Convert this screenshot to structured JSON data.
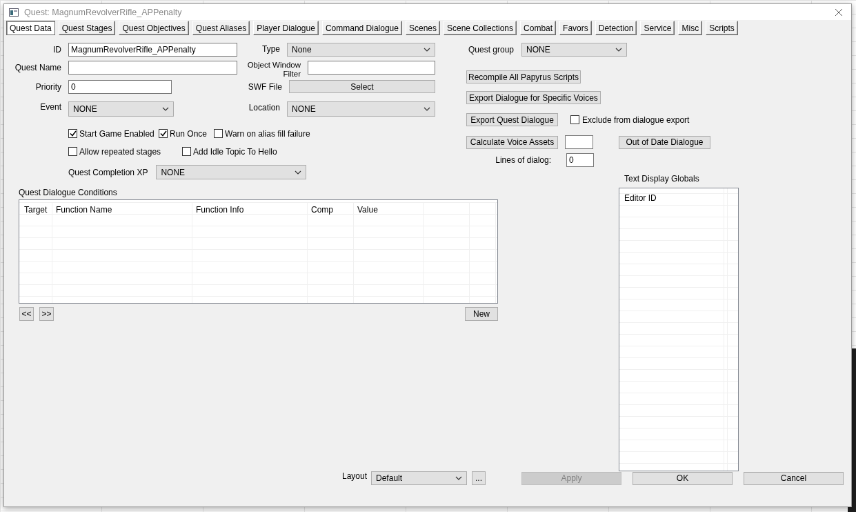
{
  "window": {
    "title": "Quest: MagnumRevolverRifle_APPenalty"
  },
  "tabs": [
    {
      "label": "Quest Data",
      "selected": true
    },
    {
      "label": "Quest Stages",
      "selected": false
    },
    {
      "label": "Quest Objectives",
      "selected": false
    },
    {
      "label": "Quest Aliases",
      "selected": false
    },
    {
      "label": "Player Dialogue",
      "selected": false
    },
    {
      "label": "Command Dialogue",
      "selected": false
    },
    {
      "label": "Scenes",
      "selected": false
    },
    {
      "label": "Scene Collections",
      "selected": false
    },
    {
      "label": "Combat",
      "selected": false
    },
    {
      "label": "Favors",
      "selected": false
    },
    {
      "label": "Detection",
      "selected": false
    },
    {
      "label": "Service",
      "selected": false
    },
    {
      "label": "Misc",
      "selected": false
    },
    {
      "label": "Scripts",
      "selected": false
    }
  ],
  "form_left": [
    {
      "kind": "text",
      "label": "ID",
      "value": "MagnumRevolverRifle_APPenalty"
    },
    {
      "kind": "text",
      "label": "Quest Name"
    },
    {
      "kind": "short_text",
      "label": "Priority",
      "value": "0"
    },
    {
      "kind": "dropdown",
      "label": "Event",
      "value": "NONE"
    }
  ],
  "form_right": [
    {
      "kind": "dropdown",
      "label": "Type",
      "value": "None"
    },
    {
      "kind": "text",
      "label": "Object Window Filter"
    },
    {
      "kind": "button",
      "label": "SWF File",
      "value": "Select"
    },
    {
      "kind": "dropdown",
      "label": "Location",
      "value": "NONE"
    }
  ],
  "option_rows": [
    {
      "items": [
        {
          "label": "Start Game Enabled",
          "checked": true
        },
        {
          "label": "Run Once",
          "checked": true
        },
        {
          "label": "Warn on alias fill failure",
          "checked": false
        }
      ]
    },
    {
      "items": [
        {
          "label": "Allow repeated stages",
          "checked": false
        },
        {
          "label": "Add Idle Topic To Hello",
          "checked": false
        }
      ]
    }
  ],
  "completion_xp": {
    "label": "Quest Completion XP",
    "value": "NONE"
  },
  "conditions": {
    "title": "Quest Dialogue Conditions",
    "columns": [
      "Target",
      "Function Name",
      "Function Info",
      "Comp",
      "Value"
    ],
    "prev": "<<",
    "next": ">>",
    "new": "New"
  },
  "quest_group": {
    "label": "Quest group",
    "value": "NONE"
  },
  "actions": {
    "recompile": "Recompile All Papyrus Scripts",
    "export_voices": "Export Dialogue for Specific Voices",
    "export_quest": "Export Quest Dialogue",
    "exclude": {
      "label": "Exclude from dialogue export",
      "checked": false
    },
    "calculate": "Calculate Voice Assets",
    "out_of_date": "Out of Date Dialogue",
    "lines_label": "Lines of dialog:",
    "lines_value": "0"
  },
  "text_display_globals": {
    "title": "Text Display Globals",
    "columns": [
      "Editor ID"
    ]
  },
  "layout": {
    "label": "Layout",
    "value": "Default",
    "more": "..."
  },
  "buttons": [
    {
      "label": "Apply",
      "disabled": true
    },
    {
      "label": "OK",
      "disabled": false
    },
    {
      "label": "Cancel",
      "disabled": false
    }
  ]
}
